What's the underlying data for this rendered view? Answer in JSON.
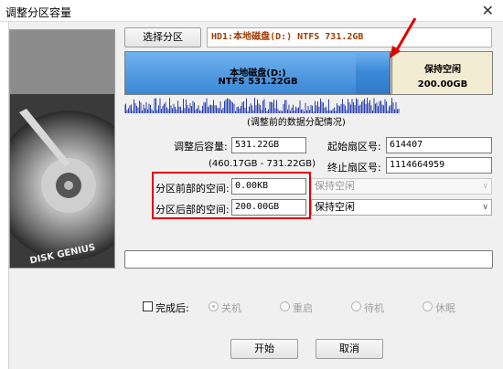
{
  "window": {
    "title": "调整分区容量",
    "close_glyph": "✕"
  },
  "disk_image": {
    "brand_text": "DISK GENIUS"
  },
  "toolbar": {
    "select_partition_label": "选择分区",
    "disk_info": "HD1:本地磁盘(D:) NTFS 731.2GB"
  },
  "partition_bar": {
    "main_name": "本地磁盘(D:)",
    "main_detail": "NTFS 531.22GB",
    "free_name": "保持空闲",
    "free_size": "200.00GB"
  },
  "caption": "(调整前的数据分配情况)",
  "form": {
    "size_label": "调整后容量:",
    "size_value": "531.22GB",
    "size_range": "(460.17GB - 731.22GB)",
    "start_sector_label": "起始扇区号:",
    "start_sector_value": "614407",
    "end_sector_label": "终止扇区号:",
    "end_sector_value": "1114664959",
    "before_label": "分区前部的空间:",
    "before_value": "0.00KB",
    "before_option": "保持空闲",
    "after_label": "分区后部的空间:",
    "after_value": "200.00GB",
    "after_option": "保持空闲"
  },
  "completion": {
    "checkbox_label": "完成后:",
    "options": [
      "关机",
      "重启",
      "待机",
      "休眠"
    ]
  },
  "buttons": {
    "start": "开始",
    "cancel": "取消"
  },
  "colors": {
    "partition_blue": "#3c8ad8",
    "free_space": "#f1ecd2",
    "highlight_red": "#e00000",
    "disk_info_text": "#a03c00"
  }
}
